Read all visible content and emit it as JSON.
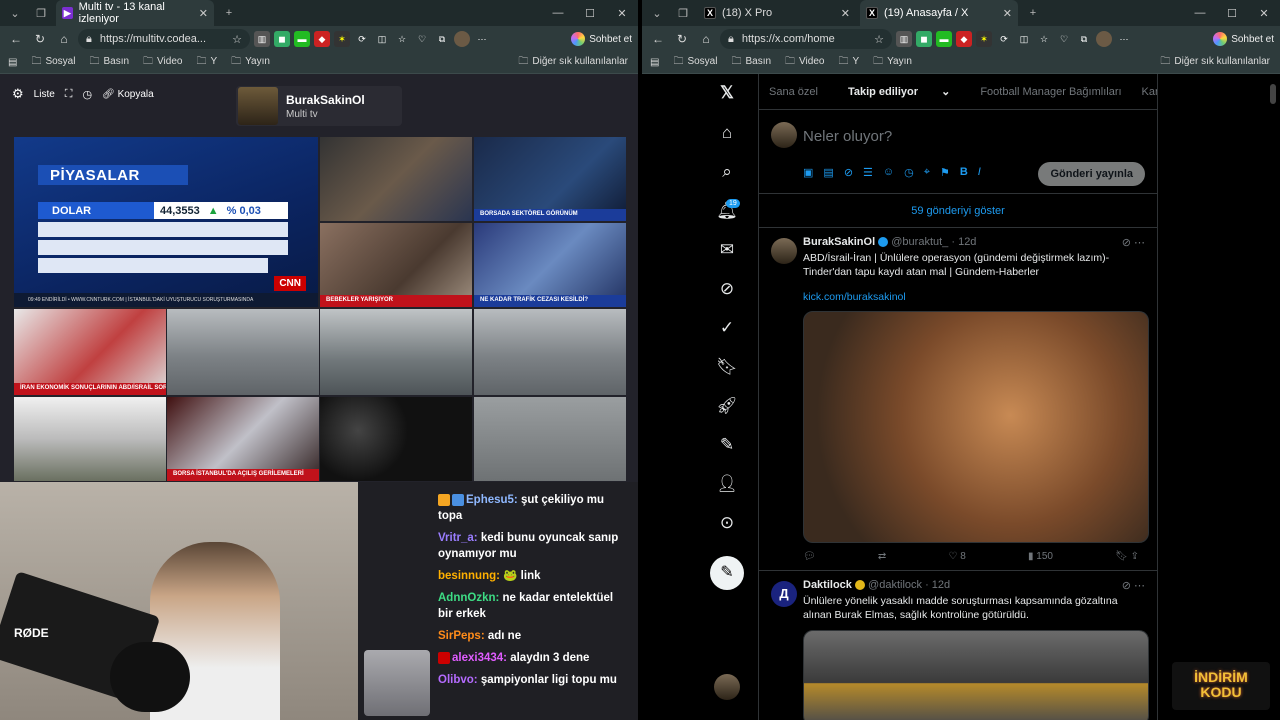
{
  "left_browser": {
    "tab_title": "Multi tv - 13 kanal izleniyor",
    "url": "https://multitv.codea...",
    "chat_button": "Sohbet et",
    "bookmarks": [
      "Sosyal",
      "Basın",
      "Video",
      "Y",
      "Yayın"
    ],
    "other_bookmarks": "Diğer sık kullanılanlar"
  },
  "multitv": {
    "toolbar": {
      "list": "Liste",
      "copy": "Kopyala"
    },
    "channel": {
      "name": "BurakSakinOl",
      "subtitle": "Multi tv"
    },
    "piyasalar": {
      "title": "PİYASALAR",
      "label": "DOLAR",
      "value": "44,3553",
      "pct_sign": "%",
      "pct": "0,03",
      "ticker": "09:49  ENDİRİLDİ   •   WWW.CNNTURK.COM   |   İSTANBUL'DAKİ UYUŞTURUCU SORUŞTURMASINDA",
      "logo": "CNN"
    },
    "lower_thirds": [
      "BORSADA SEKTÖREL GÖRÜNÜM",
      "BEBEKLER YARIŞIYOR",
      "NE KADAR TRAFİK CEZASI KESİLDİ?",
      "İRAN EKONOMİK SONUÇLARININ ABD/İSRAİL SORUMLU",
      "BORSA İSTANBUL'DA AÇILIŞ GERİLEMELERİ"
    ]
  },
  "chat": {
    "messages": [
      {
        "user": "Ephesu5:",
        "text": "şut çekiliyo mu topa",
        "color": "#8fb8ff"
      },
      {
        "user": "Vritr_a:",
        "text": "kedi bunu oyuncak sanıp oynamıyor mu",
        "color": "#9a7dff"
      },
      {
        "user": "besinnung:",
        "text": "🐸 link",
        "color": "#ffb000"
      },
      {
        "user": "AdnnOzkn:",
        "text": "ne kadar entelektüel bir erkek",
        "color": "#3ddc84"
      },
      {
        "user": "SirPeps:",
        "text": "adı ne",
        "color": "#ff8c1a"
      },
      {
        "user": "alexi3434:",
        "text": "alaydın 3 dene",
        "color": "#e05cff"
      },
      {
        "user": "Olibvo:",
        "text": "şampiyonlar ligi topu mu",
        "color": "#b56bff"
      }
    ],
    "mic_brand": "RØDE"
  },
  "right_browser": {
    "tabs": [
      "(18) X Pro",
      "(19) Anasayfa / X"
    ],
    "url": "https://x.com/home",
    "chat_button": "Sohbet et",
    "bookmarks": [
      "Sosyal",
      "Basın",
      "Video",
      "Y",
      "Yayın"
    ],
    "other_bookmarks": "Diğer sık kullanılanlar"
  },
  "x": {
    "notif_count": "19",
    "feed_tabs": [
      "Sana özel",
      "Takip ediliyor",
      "Football Manager Bağımlıları",
      "Kardeşler Kıra"
    ],
    "compose_placeholder": "Neler oluyor?",
    "post_button": "Gönderi yayınla",
    "show_more": "59 gönderiyi göster",
    "tweets": [
      {
        "name": "BurakSakinOl",
        "handle": "@buraktut_ · 12d",
        "text": "ABD/İsrail-İran | Ünlülere operasyon (gündemi değiştirmek lazım)- Tinder'dan tapu kaydı atan mal | Gündem-Haberler",
        "link": "kick.com/buraksakinol",
        "likes": "8",
        "views": "150"
      },
      {
        "name": "Daktilock",
        "handle": "@daktilock · 12d",
        "text": "Ünlülere yönelik yasaklı madde soruşturması kapsamında gözaltına alınan Burak Elmas, sağlık kontrolüne götürüldü.",
        "avatar_letter": "Д"
      }
    ]
  },
  "overlay": {
    "line1": "İNDİRİM",
    "line2": "KODU"
  }
}
